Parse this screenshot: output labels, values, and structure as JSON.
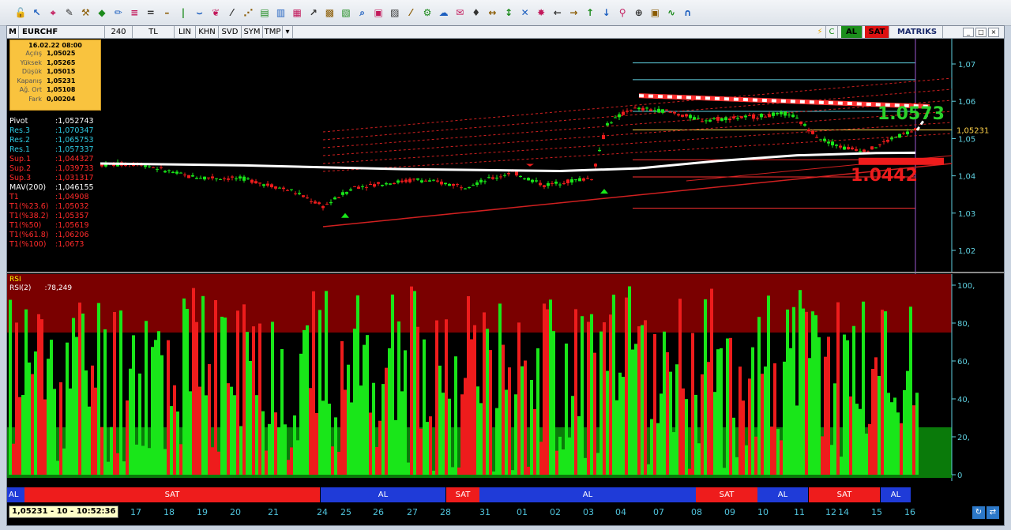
{
  "toolbar": {
    "icons": [
      "lock-open-icon",
      "cursor-icon",
      "crosshair-icon",
      "pen-icon",
      "tools-icon",
      "ruler-icon",
      "pencil-icon",
      "menu-icon",
      "equals-icon",
      "minus-icon",
      "vertical-line-icon",
      "channel-icon",
      "leaf-icon",
      "trend-icon",
      "fan-icon",
      "fib-icon",
      "bar-icon",
      "bars-icon",
      "arrow-icon",
      "grid-icon",
      "chart-icon",
      "zoom-icon",
      "box-icon",
      "ruler2-icon",
      "diagonal-icon",
      "gear-icon",
      "cloud-icon",
      "note-icon",
      "bell-icon",
      "expand-horizontal-icon",
      "expand-vertical-icon",
      "expand-all-icon",
      "star-icon",
      "arrow-left-icon",
      "arrow-right-icon",
      "arrow-up-icon",
      "arrow-down-icon",
      "search-icon",
      "zoom-in-icon",
      "picture-icon",
      "wave-icon",
      "magnet-icon"
    ]
  },
  "symbol_bar": {
    "m_label": "M",
    "symbol": "EURCHF",
    "period": "240",
    "currency": "TL",
    "scale": "LIN",
    "khn": "KHN",
    "svd": "SVD",
    "sym": "SYM",
    "tmp": "TMP",
    "buy_label": "AL",
    "sell_label": "SAT",
    "brand": "MATRIKS"
  },
  "info_box": {
    "date": "16.02.22 08:00",
    "rows": [
      {
        "label": "Açılış",
        "value": "1,05025"
      },
      {
        "label": "Yüksek",
        "value": "1,05265"
      },
      {
        "label": "Düşük",
        "value": "1,05015"
      },
      {
        "label": "Kapanış",
        "value": "1,05231"
      },
      {
        "label": "Ağ. Ort",
        "value": "1,05108"
      },
      {
        "label": "Fark",
        "value": "0,00204"
      }
    ]
  },
  "pivots": [
    {
      "label": "Pivot",
      "value": ":1,052743",
      "color": "#ffffff"
    },
    {
      "label": "Res.3",
      "value": ":1,070347",
      "color": "#2ec8e0"
    },
    {
      "label": "Res.2",
      "value": ":1,065753",
      "color": "#2ec8e0"
    },
    {
      "label": "Res.1",
      "value": ":1,057337",
      "color": "#2ec8e0"
    },
    {
      "label": "Sup.1",
      "value": ":1,044327",
      "color": "#ff2a2a"
    },
    {
      "label": "Sup.2",
      "value": ":1,039733",
      "color": "#ff2a2a"
    },
    {
      "label": "Sup.3",
      "value": ":1,031317",
      "color": "#ff2a2a"
    },
    {
      "label": "MAV(200)",
      "value": ":1,046155",
      "color": "#ffffff"
    },
    {
      "label": "T1",
      "value": ":1,04908",
      "color": "#ff2a2a"
    },
    {
      "label": "T1(%23.6)",
      "value": ":1,05032",
      "color": "#ff2a2a"
    },
    {
      "label": "T1(%38.2)",
      "value": ":1,05357",
      "color": "#ff2a2a"
    },
    {
      "label": "T1(%50)",
      "value": ":1,05619",
      "color": "#ff2a2a"
    },
    {
      "label": "T1(%61.8)",
      "value": ":1,06206",
      "color": "#ff2a2a"
    },
    {
      "label": "T1(%100)",
      "value": ":1,0673",
      "color": "#ff2a2a"
    }
  ],
  "price_axis": {
    "ticks": [
      "1,07",
      "1,06",
      "1,05",
      "1,04",
      "1,03",
      "1,02"
    ],
    "current": "1,05231"
  },
  "annotations": {
    "target_up": "1.0573",
    "target_down": "1.0442"
  },
  "rsi": {
    "title": "RSI",
    "label": "RSI(2)",
    "value": ":78,249",
    "ticks": [
      "100,",
      "80,",
      "60,",
      "40,",
      "20,",
      "0"
    ]
  },
  "signals": [
    {
      "label": "AL",
      "type": "buy"
    },
    {
      "label": "SAT",
      "type": "sell"
    },
    {
      "label": "AL",
      "type": "buy"
    },
    {
      "label": "SAT",
      "type": "sell"
    },
    {
      "label": "AL",
      "type": "buy"
    },
    {
      "label": "SAT",
      "type": "sell"
    },
    {
      "label": "AL",
      "type": "buy"
    },
    {
      "label": "SAT",
      "type": "sell"
    },
    {
      "label": "AL",
      "type": "buy"
    }
  ],
  "date_axis": {
    "current": "1,05231 - 10 - 10:52:36",
    "labels": [
      "17",
      "18",
      "19",
      "20",
      "21",
      "24",
      "25",
      "26",
      "27",
      "28",
      "31",
      "01",
      "02",
      "03",
      "04",
      "07",
      "08",
      "09",
      "10",
      "11",
      "12",
      "14",
      "15",
      "16"
    ]
  },
  "colors": {
    "buy": "#1f3bd8",
    "sell": "#ee1c1c",
    "up_candle": "#19e619",
    "down_candle": "#ee1c1c"
  }
}
